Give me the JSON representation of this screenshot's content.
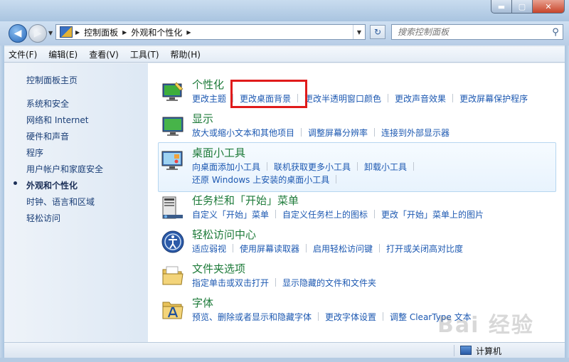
{
  "window": {
    "buttons": {
      "minimize": "▬",
      "maximize": "▢",
      "close": "✕"
    }
  },
  "navbar": {
    "breadcrumbs": [
      "控制面板",
      "外观和个性化"
    ],
    "search_placeholder": "搜索控制面板"
  },
  "menu": [
    "文件(F)",
    "编辑(E)",
    "查看(V)",
    "工具(T)",
    "帮助(H)"
  ],
  "sidebar": {
    "home": "控制面板主页",
    "items": [
      "系统和安全",
      "网络和 Internet",
      "硬件和声音",
      "程序",
      "用户帐户和家庭安全",
      "外观和个性化",
      "时钟、语言和区域",
      "轻松访问"
    ],
    "current_index": 5
  },
  "categories": [
    {
      "title": "个性化",
      "icon": "personalization-icon",
      "links": [
        [
          "更改主题",
          "更改桌面背景",
          "更改半透明窗口颜色",
          "更改声音效果",
          "更改屏幕保护程序"
        ]
      ]
    },
    {
      "title": "显示",
      "icon": "display-icon",
      "links": [
        [
          "放大或缩小文本和其他项目",
          "调整屏幕分辨率",
          "连接到外部显示器"
        ]
      ]
    },
    {
      "title": "桌面小工具",
      "icon": "gadgets-icon",
      "links": [
        [
          "向桌面添加小工具",
          "联机获取更多小工具",
          "卸载小工具"
        ],
        [
          "还原 Windows 上安装的桌面小工具"
        ]
      ]
    },
    {
      "title": "任务栏和「开始」菜单",
      "icon": "taskbar-icon",
      "links": [
        [
          "自定义「开始」菜单",
          "自定义任务栏上的图标",
          "更改「开始」菜单上的图片"
        ]
      ]
    },
    {
      "title": "轻松访问中心",
      "icon": "ease-of-access-icon",
      "links": [
        [
          "适应弱视",
          "使用屏幕读取器",
          "启用轻松访问键",
          "打开或关闭高对比度"
        ]
      ]
    },
    {
      "title": "文件夹选项",
      "icon": "folder-options-icon",
      "links": [
        [
          "指定单击或双击打开",
          "显示隐藏的文件和文件夹"
        ]
      ]
    },
    {
      "title": "字体",
      "icon": "fonts-icon",
      "links": [
        [
          "预览、删除或者显示和隐藏字体",
          "更改字体设置",
          "调整 ClearType 文本"
        ]
      ]
    }
  ],
  "status": {
    "text": "计算机"
  },
  "watermark": {
    "text": "Bai 经验"
  },
  "colors": {
    "title_green": "#1e7b3a",
    "link_blue": "#1c58b1",
    "highlight_red": "#e01b1b"
  }
}
